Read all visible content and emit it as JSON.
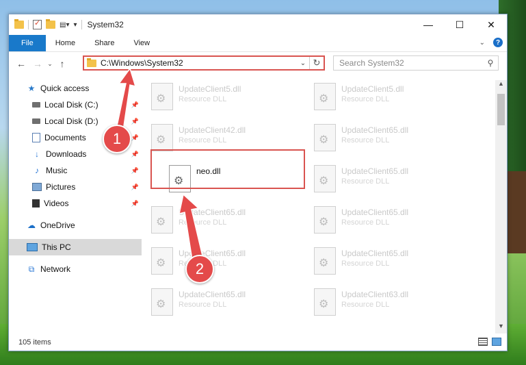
{
  "window": {
    "title": "System32"
  },
  "ribbon": {
    "tabs": [
      "File",
      "Home",
      "Share",
      "View"
    ]
  },
  "titlebar": {
    "minimize": "—",
    "maximize": "☐",
    "close": "✕"
  },
  "navigation": {
    "back": "←",
    "forward": "→",
    "up": "↑",
    "address": "C:\\Windows\\System32",
    "search_placeholder": "Search System32"
  },
  "sidebar": {
    "quick_access": "Quick access",
    "pinned": [
      {
        "label": "Local Disk (C:)",
        "icon": "drive-icon"
      },
      {
        "label": "Local Disk (D:)",
        "icon": "drive-icon"
      },
      {
        "label": "Documents",
        "icon": "documents-icon"
      },
      {
        "label": "Downloads",
        "icon": "downloads-icon"
      },
      {
        "label": "Music",
        "icon": "music-icon"
      },
      {
        "label": "Pictures",
        "icon": "pictures-icon"
      },
      {
        "label": "Videos",
        "icon": "videos-icon"
      }
    ],
    "onedrive": "OneDrive",
    "this_pc": "This PC",
    "network": "Network"
  },
  "files": {
    "rows": [
      [
        {
          "name": "UpdateClient5.dll",
          "type": "Resource DLL"
        },
        {
          "name": "UpdateClient5.dll",
          "type": "Resource DLL"
        }
      ],
      [
        {
          "name": "UpdateClient42.dll",
          "type": "Resource DLL"
        },
        {
          "name": "UpdateClient65.dll",
          "type": "Resource DLL"
        }
      ],
      [
        {
          "name": "neo.dll",
          "type": ""
        },
        {
          "name": "UpdateClient65.dll",
          "type": "Resource DLL"
        }
      ],
      [
        {
          "name": "UpdateClient65.dll",
          "type": "Resource DLL"
        },
        {
          "name": "UpdateClient65.dll",
          "type": "Resource DLL"
        }
      ],
      [
        {
          "name": "UpdateClient65.dll",
          "type": "Resource DLL"
        },
        {
          "name": "UpdateClient65.dll",
          "type": "Resource DLL"
        }
      ],
      [
        {
          "name": "UpdateClient65.dll",
          "type": "Resource DLL"
        },
        {
          "name": "UpdateClient63.dll",
          "type": "Resource DLL"
        }
      ]
    ]
  },
  "status": {
    "item_count": "105 items"
  },
  "annotations": {
    "marker1": "1",
    "marker2": "2"
  },
  "colors": {
    "accent": "#1979ca",
    "highlight": "#d9534f",
    "marker": "#e44a4a"
  }
}
